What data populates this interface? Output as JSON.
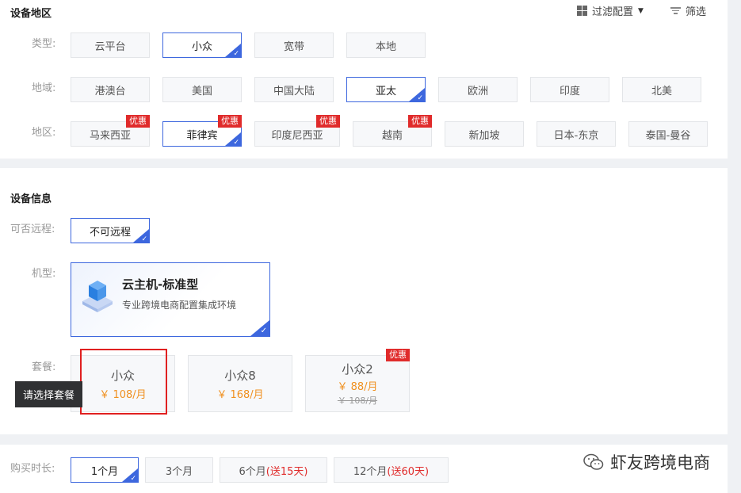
{
  "region_section": {
    "title": "设备地区",
    "toolbar": {
      "filter_config": "过滤配置",
      "screen": "筛选"
    },
    "type_label": "类型:",
    "types": [
      {
        "label": "云平台",
        "selected": false
      },
      {
        "label": "小众",
        "selected": true
      },
      {
        "label": "宽带",
        "selected": false
      },
      {
        "label": "本地",
        "selected": false
      }
    ],
    "domain_label": "地域:",
    "domains": [
      {
        "label": "港澳台",
        "selected": false
      },
      {
        "label": "美国",
        "selected": false
      },
      {
        "label": "中国大陆",
        "selected": false
      },
      {
        "label": "亚太",
        "selected": true
      },
      {
        "label": "欧洲",
        "selected": false
      },
      {
        "label": "印度",
        "selected": false
      },
      {
        "label": "北美",
        "selected": false
      }
    ],
    "area_label": "地区:",
    "badge_text": "优惠",
    "areas": [
      {
        "label": "马来西亚",
        "selected": false,
        "discount": true
      },
      {
        "label": "菲律宾",
        "selected": true,
        "discount": true
      },
      {
        "label": "印度尼西亚",
        "selected": false,
        "discount": true
      },
      {
        "label": "越南",
        "selected": false,
        "discount": true
      },
      {
        "label": "新加坡",
        "selected": false,
        "discount": false
      },
      {
        "label": "日本-东京",
        "selected": false,
        "discount": false
      },
      {
        "label": "泰国-曼谷",
        "selected": false,
        "discount": false
      }
    ]
  },
  "device_section": {
    "title": "设备信息",
    "remote_label": "可否远程:",
    "remote_option": "不可远程",
    "model_label": "机型:",
    "model": {
      "name": "云主机-标准型",
      "desc": "专业跨境电商配置集成环境"
    },
    "plan_label": "套餐:",
    "plans": [
      {
        "name": "小众",
        "price": "￥ 108/月",
        "original": "",
        "discount": false
      },
      {
        "name": "小众8",
        "price": "￥ 168/月",
        "original": "",
        "discount": false
      },
      {
        "name": "小众2",
        "price": "￥ 88/月",
        "original": "￥ 108/月",
        "discount": true
      }
    ],
    "plan_badge": "优惠",
    "tooltip": "请选择套餐"
  },
  "duration_section": {
    "label": "购买时长:",
    "options": [
      {
        "main": "1个月",
        "extra": "",
        "selected": true
      },
      {
        "main": "3个月",
        "extra": "",
        "selected": false
      },
      {
        "main": "6个月",
        "extra": "(送15天)",
        "selected": false
      },
      {
        "main": "12个月",
        "extra": "(送60天)",
        "selected": false
      }
    ]
  },
  "watermark": "虾友跨境电商",
  "colors": {
    "accent": "#3d67de",
    "badge": "#e02b2b",
    "price": "#f0901f"
  }
}
